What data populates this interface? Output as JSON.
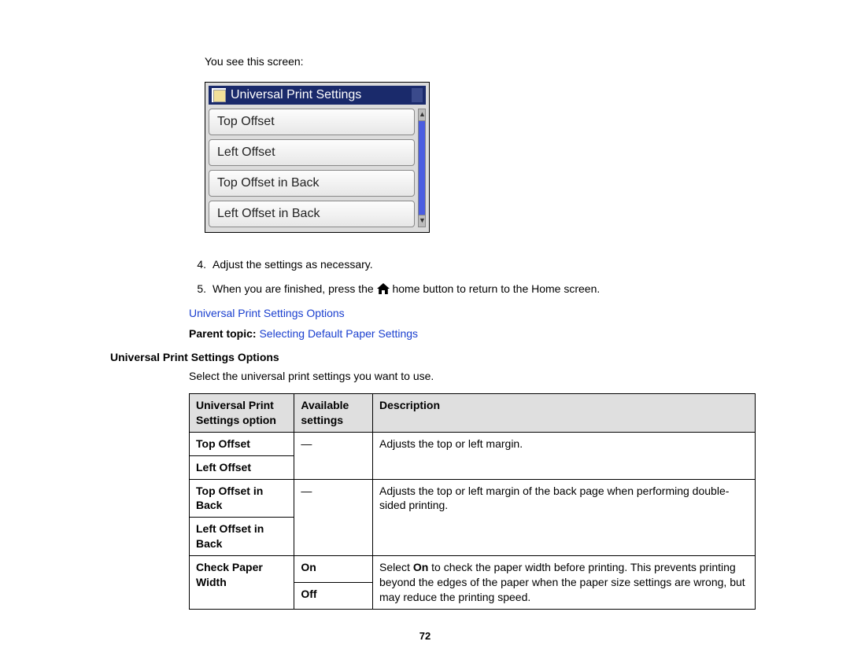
{
  "intro": "You see this screen:",
  "device": {
    "title": "Universal Print Settings",
    "items": [
      "Top Offset",
      "Left Offset",
      "Top Offset in Back",
      "Left Offset in Back"
    ],
    "scroll_up": "▲",
    "scroll_down": "▼"
  },
  "steps": {
    "s4": {
      "num": "4.",
      "text": "Adjust the settings as necessary."
    },
    "s5": {
      "num": "5.",
      "before": "When you are finished, press the ",
      "after": " home button to return to the Home screen."
    }
  },
  "link_options": "Universal Print Settings Options",
  "parent": {
    "label": "Parent topic: ",
    "link": "Selecting Default Paper Settings"
  },
  "section_heading": "Universal Print Settings Options",
  "section_intro": "Select the universal print settings you want to use.",
  "table": {
    "headers": {
      "col1": "Universal Print Settings option",
      "col2": "Available settings",
      "col3": "Description"
    },
    "r1": {
      "opt1": "Top Offset",
      "opt2": "Left Offset",
      "avail": "—",
      "desc": "Adjusts the top or left margin."
    },
    "r2": {
      "opt1": "Top Offset in Back",
      "opt2": "Left Offset in Back",
      "avail": "—",
      "desc": "Adjusts the top or left margin of the back page when performing double-sided printing."
    },
    "r3": {
      "opt": "Check Paper Width",
      "avail1": "On",
      "avail2": "Off",
      "desc_before": "Select ",
      "desc_bold": "On",
      "desc_after": " to check the paper width before printing. This prevents printing beyond the edges of the paper when the paper size settings are wrong, but may reduce the printing speed."
    }
  },
  "page_number": "72"
}
